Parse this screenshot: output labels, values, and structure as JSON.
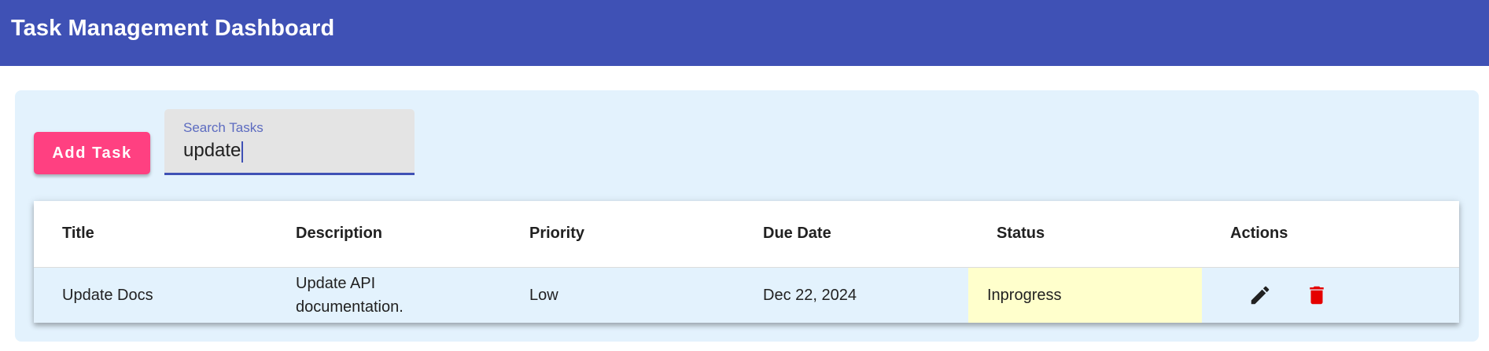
{
  "app": {
    "title": "Task Management Dashboard"
  },
  "toolbar": {
    "add_label": "Add Task",
    "search": {
      "label": "Search Tasks",
      "value": "update"
    }
  },
  "table": {
    "columns": [
      "Title",
      "Description",
      "Priority",
      "Due Date",
      "Status",
      "Actions"
    ],
    "rows": [
      {
        "title": "Update Docs",
        "description": "Update API documentation.",
        "priority": "Low",
        "due_date": "Dec 22, 2024",
        "status": "Inprogress",
        "actions": [
          "edit-icon",
          "delete-icon"
        ]
      }
    ]
  },
  "colors": {
    "appbar": "#3f51b5",
    "accent_button": "#ff4081",
    "panel_bg": "#e3f2fd",
    "status_bg": "#ffffcc",
    "delete_icon": "#e50000"
  }
}
